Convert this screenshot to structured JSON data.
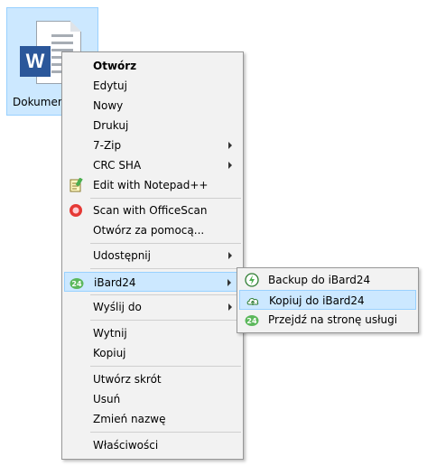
{
  "desktop": {
    "file_label": "Dokument",
    "word_letter": "W"
  },
  "menu": {
    "items": [
      {
        "label": "Otwórz",
        "bold": true
      },
      {
        "label": "Edytuj"
      },
      {
        "label": "Nowy"
      },
      {
        "label": "Drukuj"
      },
      {
        "label": "7-Zip",
        "submenu": true
      },
      {
        "label": "CRC SHA",
        "submenu": true
      },
      {
        "label": "Edit with Notepad++",
        "icon": "notepad-plus-plus-icon"
      },
      {
        "label": "Scan with OfficeScan",
        "icon": "officescan-icon"
      },
      {
        "label": "Otwórz za pomocą..."
      },
      {
        "label": "Udostępnij",
        "submenu": true
      },
      {
        "label": "iBard24",
        "submenu": true,
        "icon": "ibard24-icon",
        "highlighted": true
      },
      {
        "label": "Wyślij do",
        "submenu": true
      },
      {
        "label": "Wytnij"
      },
      {
        "label": "Kopiuj"
      },
      {
        "label": "Utwórz skrót"
      },
      {
        "label": "Usuń"
      },
      {
        "label": "Zmień nazwę"
      },
      {
        "label": "Właściwości"
      }
    ]
  },
  "submenu": {
    "items": [
      {
        "label": "Backup do iBard24",
        "icon": "backup-icon"
      },
      {
        "label": "Kopiuj do iBard24",
        "icon": "cloud-upload-icon",
        "highlighted": true
      },
      {
        "label": "Przejdź na stronę usługi",
        "icon": "ibard24-icon"
      }
    ]
  },
  "colors": {
    "selection_bg": "#cce8ff",
    "selection_border": "#99d1ff",
    "menu_bg": "#f2f2f2",
    "word_blue": "#2b579a",
    "ibard_green": "#5cb85c"
  }
}
